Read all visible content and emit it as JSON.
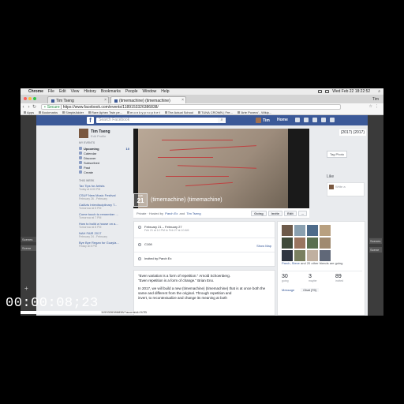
{
  "menubar": {
    "items": [
      "Chrome",
      "File",
      "Edit",
      "View",
      "History",
      "Bookmarks",
      "People",
      "Window",
      "Help"
    ],
    "clock": "Wed Feb 22  18:22:52"
  },
  "browser": {
    "tabs": [
      {
        "label": "Tim Tseng"
      },
      {
        "label": "(timemachine) (timemachine)"
      }
    ],
    "user": "Tim",
    "url_secure": "Secure",
    "url": "https://www.facebook.com/events/1189153326386838/",
    "bookmarks": [
      "Apps",
      "Bookmarks",
      "SimpleAdder",
      "Rare Aphex Twin pe...",
      "m o n k y p r o p h e t",
      "The Actual School",
      "TUNA CROWN | Fre...",
      "'Arte Povera' - Wikip..."
    ]
  },
  "facebook": {
    "search_placeholder": "Search Facebook",
    "user_short": "Tim",
    "home": "Home",
    "profile": {
      "name": "Tim Tseng",
      "edit": "Edit Profile"
    },
    "my_events_header": "MY EVENTS",
    "nav": [
      {
        "label": "Upcoming",
        "count": "10"
      },
      {
        "label": "Calendar",
        "count": ""
      },
      {
        "label": "Discover",
        "count": ""
      },
      {
        "label": "Subscribed",
        "count": ""
      },
      {
        "label": "Past",
        "count": ""
      },
      {
        "label": "Create",
        "count": ""
      }
    ],
    "this_week_header": "THIS WEEK",
    "events": [
      {
        "title": "Tax Tips for Artists",
        "date": "Today at 6:00 PM"
      },
      {
        "title": "CSUF New Music Festival",
        "date": "February 26 - February"
      },
      {
        "title": "CalArts Interdisciplinary T...",
        "date": "Tomorrow at 5 PM"
      },
      {
        "title": "Come touch to remember ...",
        "date": "Tomorrow at 7 PM"
      },
      {
        "title": "How to build a house on a...",
        "date": "Tomorrow at 8 PM"
      },
      {
        "title": "NAH FAIR 2017",
        "date": "February 24 - February"
      },
      {
        "title": "Bye Bye Regan for Guayla...",
        "date": "Friday at 8 PM"
      }
    ],
    "event": {
      "month": "FEB",
      "day": "21",
      "title": "(timemachine) (timemachine)",
      "privacy": "Private",
      "hosted_by_label": "Hosted by",
      "host1": "Parch Ex",
      "host_and": "and",
      "host2": "Tim Tseng",
      "buttons": [
        "Going",
        "Invite",
        "Edit",
        "..."
      ],
      "date_range": "February 21 – February 27",
      "time_range": "Feb 21 at 12 PM to Feb 27 at 10 AM",
      "location": "C108",
      "show_map": "Show Map",
      "invited_by": "Invited by Parch Ex",
      "desc_lines": [
        "\"Even variation is a form of repetition.\" Arnold Schoenberg.",
        "\"Even repetition is a form of change.\" Brian Eno.",
        "In 2017, we will build a new (timemachine) (timemachine) that is at once both the same and different from the original. Through repetition and",
        "invert, to recontextualize and change its meaning at both"
      ]
    },
    "right": {
      "dates_label": "(2017) (2017)",
      "tag_photo": "Tag Photo",
      "like": "Like",
      "write": "Write a",
      "going_line_names": "Parch, Steve",
      "going_line_rest": "and 20 other friends are going",
      "stats": [
        {
          "n": "30",
          "l": "going"
        },
        {
          "n": "3",
          "l": "maybe"
        },
        {
          "n": "89",
          "l": "invited"
        }
      ],
      "message": "Message",
      "chat": "Chat (79)"
    }
  },
  "side_apps": {
    "left_header": "Scenes",
    "left_item": "Scene",
    "left_plus": "+",
    "right_items": [
      "Scenes",
      "Scene"
    ]
  },
  "overlay": {
    "timecode": "00:00:08;23",
    "url_fragment": "1153326386838/?acontext=%7B"
  },
  "colors": {
    "fb_blue": "#3b5998",
    "link": "#365899",
    "background": "#000000"
  }
}
